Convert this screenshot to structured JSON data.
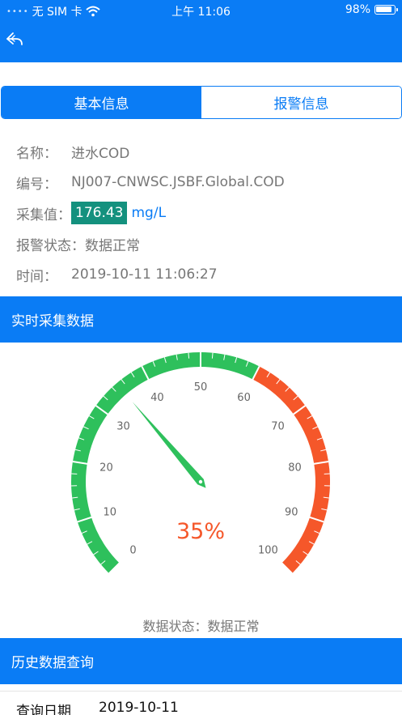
{
  "status_bar": {
    "signal_dots": "••••",
    "carrier": "无 SIM 卡",
    "wifi_icon": "wifi-icon",
    "time": "上午 11:06",
    "battery": "98%"
  },
  "nav": {
    "back_icon": "back-arrow-icon"
  },
  "tabs": [
    {
      "label": "基本信息",
      "active": true
    },
    {
      "label": "报警信息",
      "active": false
    }
  ],
  "info": {
    "name_label": "名称：",
    "name_value": "进水COD",
    "code_label": "编号：",
    "code_value": "NJ007-CNWSC.JSBF.Global.COD",
    "collect_label": "采集值：",
    "collect_value": "176.43",
    "collect_unit": "mg/L",
    "alarm_label": "报警状态：",
    "alarm_value": "数据正常",
    "time_label": "时间：",
    "time_value": "2019-10-11 11:06:27"
  },
  "realtime": {
    "title": "实时采集数据",
    "gauge": {
      "min": 0,
      "max": 100,
      "value": 35,
      "ticks": [
        "0",
        "10",
        "20",
        "30",
        "40",
        "50",
        "60",
        "70",
        "80",
        "90",
        "100"
      ],
      "value_text": "35%",
      "green_color": "#2ec05c",
      "red_color": "#f5572a",
      "threshold": 60
    },
    "status_text": "数据状态：数据正常"
  },
  "history": {
    "title": "历史数据查询",
    "date_label": "查询日期",
    "date_value": "2019-10-11"
  },
  "colors": {
    "primary": "#0a7cf5",
    "value_box": "#14917e"
  }
}
